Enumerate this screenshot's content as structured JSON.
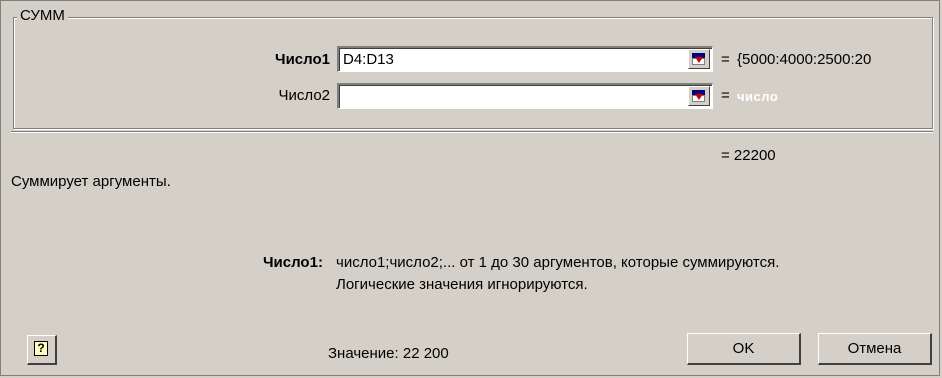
{
  "dialog": {
    "function_name": "СУММ",
    "args": [
      {
        "label": "Число1",
        "bold": true,
        "value": "D4:D13",
        "result": "{5000:4000:2500:20"
      },
      {
        "label": "Число2",
        "bold": false,
        "value": "",
        "result": "число"
      }
    ],
    "equals_sign": "=",
    "description": "Суммирует аргументы.",
    "total_result": "= 22200",
    "arg_help": {
      "label": "Число1:",
      "line1": "число1;число2;... от 1 до 30 аргументов, которые суммируются.",
      "line2": "Логические значения игнорируются."
    },
    "value_text": "Значение: 22 200",
    "ok_label": "OK",
    "cancel_label": "Отмена"
  },
  "colors": {
    "face": "#d4d0c8",
    "shadow": "#808080",
    "highlight": "#ffffff"
  },
  "icons": {
    "help": "help-question-icon",
    "collapse": "collapse-dialog-icon"
  }
}
